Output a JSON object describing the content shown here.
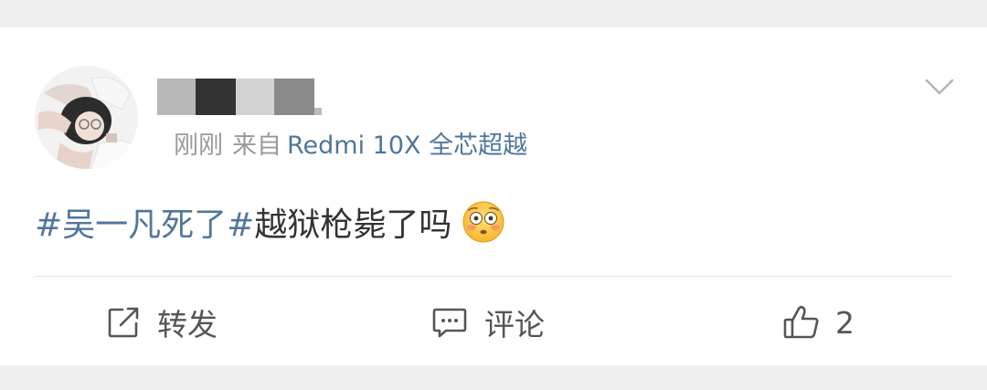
{
  "post": {
    "time": "刚刚",
    "from_label": "来自",
    "device": "Redmi 10X 全芯超越",
    "content": {
      "topic": "#吴一凡死了#",
      "text": "越狱枪毙了吗",
      "emoji": "flushed-face"
    }
  },
  "actions": {
    "repost_label": "转发",
    "comment_label": "评论",
    "like_count": "2"
  },
  "icons": {
    "menu": "chevron-down-icon",
    "repost": "share-icon",
    "comment": "comment-icon",
    "like": "thumbs-up-icon"
  },
  "colors": {
    "link": "#50769c",
    "text": "#333333",
    "meta": "#999999",
    "background": "#efefef"
  }
}
